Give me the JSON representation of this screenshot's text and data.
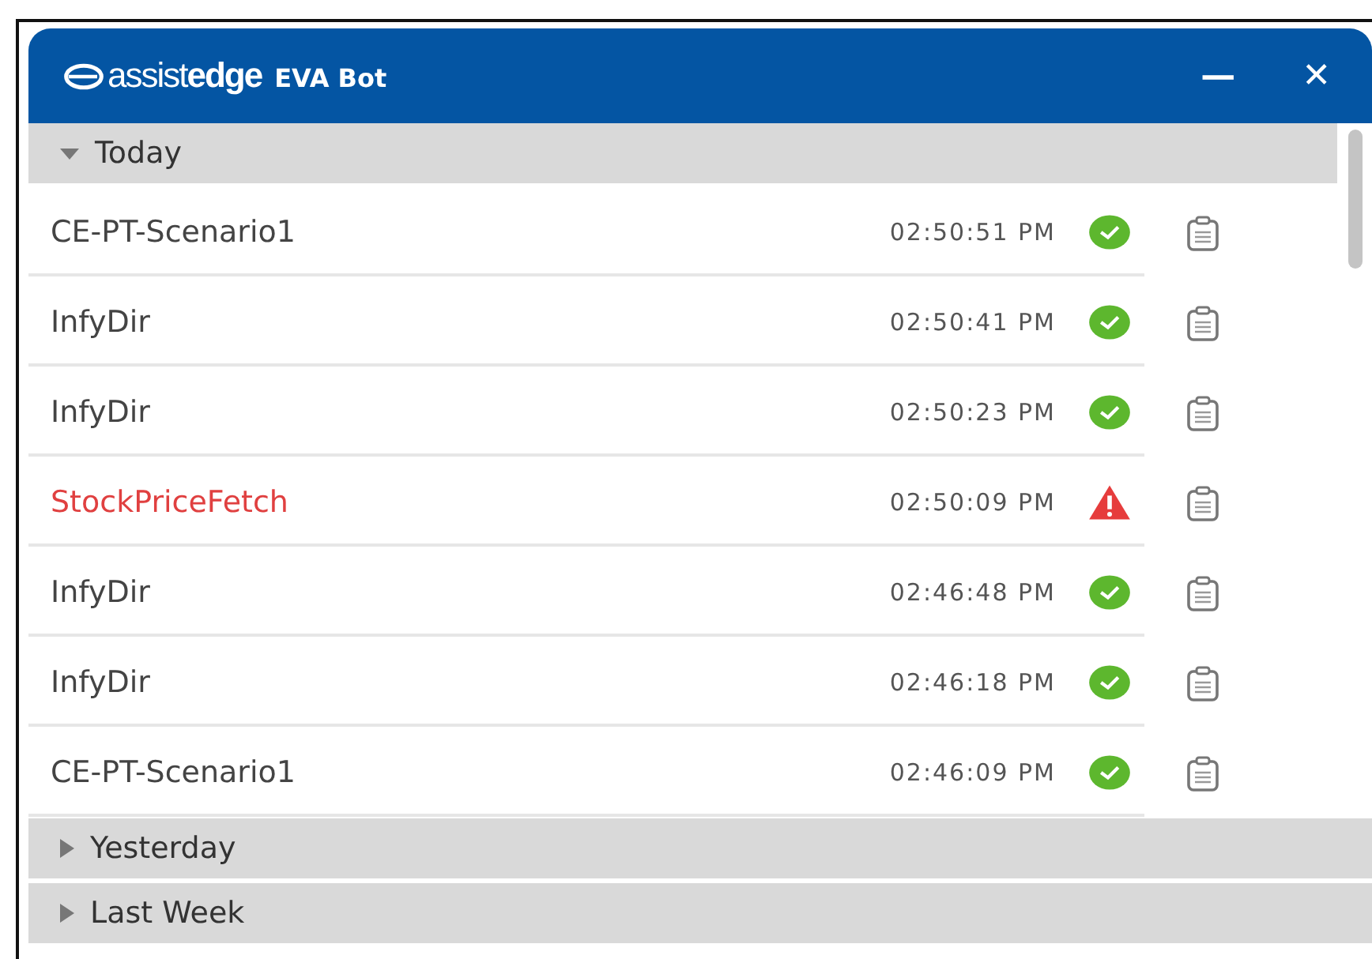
{
  "window": {
    "logo": "assist**edge**",
    "title": "EVA Bot",
    "buttons": [
      "—",
      "✕"
    ]
  },
  "groups": [
    {
      "label": "Today",
      "expanded": true,
      "rows": [
        {
          "name": "CE-PT-Scenario1",
          "time": "02:50:51 PM",
          "kind": "success"
        },
        {
          "name": "InfyDir",
          "time": "02:50:41 PM",
          "kind": "success"
        },
        {
          "name": "InfyDir",
          "time": "02:50:23 PM",
          "kind": "success"
        },
        {
          "name": "StockPriceFetch",
          "time": "02:50:09 PM",
          "kind": "error"
        },
        {
          "name": "InfyDir",
          "time": "02:46:48 PM",
          "kind": "success"
        },
        {
          "name": "InfyDir",
          "time": "02:46:18 PM",
          "kind": "success"
        },
        {
          "name": "CE-PT-Scenario1",
          "time": "02:46:09 PM",
          "kind": "success"
        }
      ]
    },
    {
      "label": "Yesterday",
      "expanded": false
    },
    {
      "label": "Last Week",
      "expanded": false
    }
  ]
}
